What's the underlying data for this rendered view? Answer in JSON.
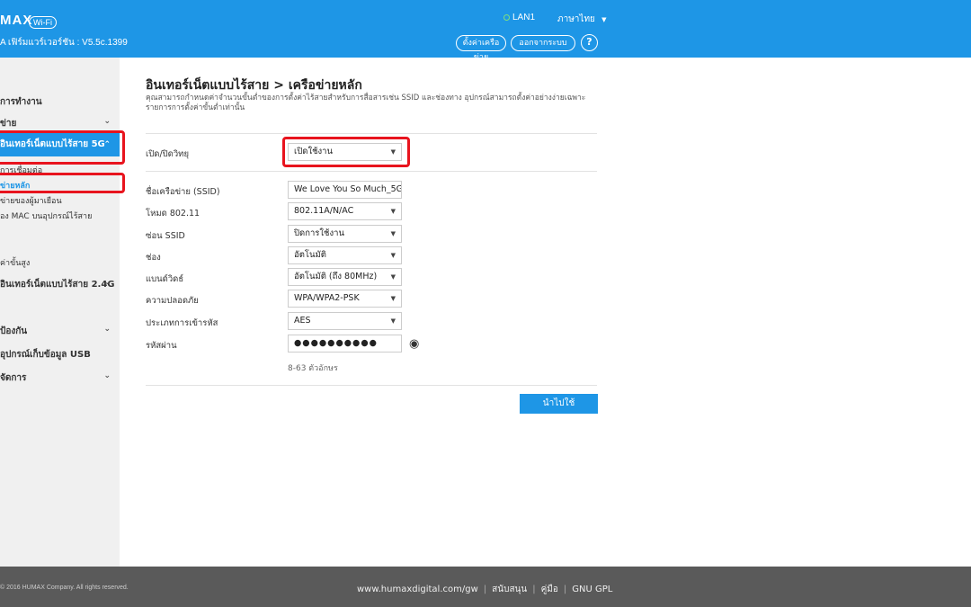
{
  "header": {
    "logo": "MAX",
    "wifi_badge": "Wi-Fi",
    "firmware": "A เฟิร์มแวร์เวอร์ชัน : V5.5c.1399",
    "lan_status": "LAN1",
    "language": "ภาษาไทย",
    "network_settings_button": "ตั้งค่าเครือข่าย",
    "logout_button": "ออกจากระบบ",
    "help_button": "?"
  },
  "sidebar": {
    "items": [
      {
        "label": "การทำงาน"
      },
      {
        "label": "ข่าย"
      },
      {
        "label": "อินเทอร์เน็ตแบบไร้สาย 5G"
      },
      {
        "label": "การเชื่อมต่อ"
      },
      {
        "label": "ข่ายหลัก"
      },
      {
        "label": "ข่ายของผู้มาเยือน"
      },
      {
        "label": "อง MAC บนอุปกรณ์ไร้สาย"
      },
      {
        "label": "ค่าขั้นสูง"
      },
      {
        "label": "อินเทอร์เน็ตแบบไร้สาย 2.4G"
      },
      {
        "label": "ป้องกัน"
      },
      {
        "label": "อุปกรณ์เก็บข้อมูล USB"
      },
      {
        "label": "จัดการ"
      }
    ]
  },
  "main": {
    "title": "อินเทอร์เน็ตแบบไร้สาย > เครือข่ายหลัก",
    "description": "คุณสามารถกำหนดค่าจำนวนขั้นต่ำของการตั้งค่าไร้สายสำหรับการสื่อสารเช่น SSID และช่องทาง อุปกรณ์สามารถตั้งค่าอย่างง่ายเฉพาะรายการการตั้งค่าขั้นต่ำเท่านั้น",
    "fields": {
      "radio": {
        "label": "เปิด/ปิดวิทยุ",
        "value": "เปิดใช้งาน"
      },
      "ssid": {
        "label": "ชื่อเครือข่าย (SSID)",
        "value": "We Love You So Much_5GH"
      },
      "mode": {
        "label": "โหมด 802.11",
        "value": "802.11A/N/AC"
      },
      "hide_ssid": {
        "label": "ซ่อน SSID",
        "value": "ปิดการใช้งาน"
      },
      "channel": {
        "label": "ช่อง",
        "value": "อัตโนมัติ"
      },
      "bandwidth": {
        "label": "แบนด์วิดธ์",
        "value": "อัตโนมัติ (ถึง 80MHz)"
      },
      "security": {
        "label": "ความปลอดภัย",
        "value": "WPA/WPA2-PSK"
      },
      "encryption": {
        "label": "ประเภทการเข้ารหัส",
        "value": "AES"
      },
      "password": {
        "label": "รหัสผ่าน",
        "value": "●●●●●●●●●●"
      }
    },
    "password_hint": "8-63 ตัวอักษร",
    "apply_button": "นำไปใช้"
  },
  "footer": {
    "copyright": "© 2016 HUMAX Company. All rights reserved.",
    "links": [
      "www.humaxdigital.com/gw",
      "สนับสนุน",
      "คู่มือ",
      "GNU GPL"
    ]
  },
  "colors": {
    "header_blue": "#1e96e6",
    "highlight_red": "#e8141e",
    "footer_gray": "#5a5a5a"
  }
}
